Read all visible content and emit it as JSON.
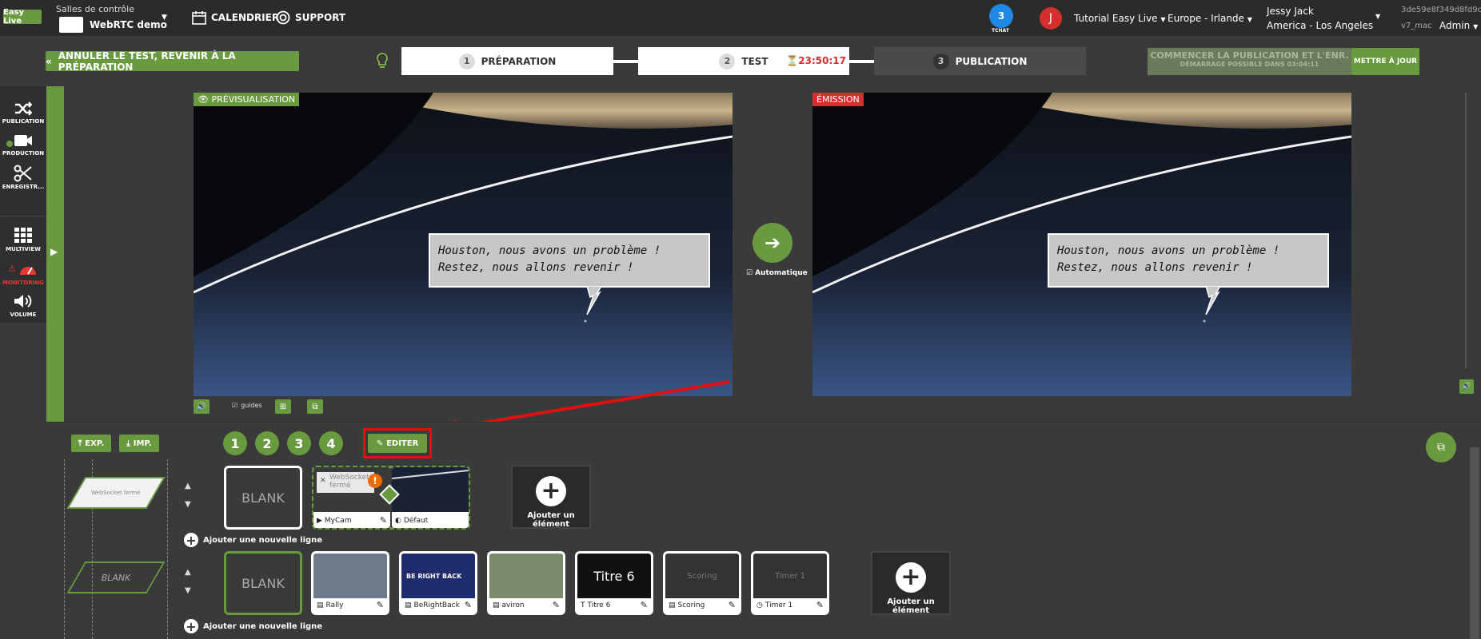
{
  "header": {
    "logo_text": "Easy Live",
    "room_label": "Salles de contrôle",
    "room_name": "WebRTC demo",
    "calendar": "CALENDRIER",
    "support": "SUPPORT",
    "chat_count": "3",
    "chat_label": "TCHAT",
    "user_initial": "J",
    "tutorial": "Tutorial Easy Live",
    "region": "Europe - Irlande",
    "user_name": "Jessy Jack",
    "timezone": "America - Los Angeles",
    "instance_id": "3de59e8f349d8fd9c...",
    "version": "v7_mac",
    "role": "Admin"
  },
  "subbar": {
    "cancel_test": "ANNULER LE TEST, REVENIR À LA PRÉPARATION",
    "steps": [
      {
        "num": "1",
        "label": "PRÉPARATION"
      },
      {
        "num": "2",
        "label": "TEST",
        "timer": "23:50:17"
      },
      {
        "num": "3",
        "label": "PUBLICATION"
      }
    ],
    "start_publication": "COMMENCER LA PUBLICATION ET L'ENR.",
    "start_possible": "DÉMARRAGE POSSIBLE DANS 03:04:11",
    "update": "METTRE À JOUR"
  },
  "sidebar": {
    "items": [
      {
        "label": "PUBLICATION",
        "icon": "shuffle-icon"
      },
      {
        "label": "PRODUCTION",
        "icon": "video-camera-icon"
      },
      {
        "label": "ENREGISTR...",
        "icon": "scissors-icon"
      },
      {
        "label": "MULTIVIEW",
        "icon": "grid-icon"
      },
      {
        "label": "MONITORING",
        "icon": "gauge-icon"
      },
      {
        "label": "VOLUME",
        "icon": "speaker-icon"
      }
    ]
  },
  "preview": {
    "label": "PRÉVISUALISATION",
    "bubble_line1": "Houston, nous avons un problème !",
    "bubble_line2": "Restez, nous allons revenir !",
    "guides": "guides"
  },
  "emission": {
    "label": "ÉMISSION",
    "bubble_line1": "Houston, nous avons un problème !",
    "bubble_line2": "Restez, nous allons revenir !"
  },
  "transition": {
    "auto_label": "Automatique"
  },
  "lower": {
    "exp": "EXP.",
    "imp": "IMP.",
    "scene_numbers": [
      "1",
      "2",
      "3",
      "4"
    ],
    "edit": "EDITER",
    "layout1_label": "WebSocket fermé",
    "layout2_label": "BLANK",
    "row1": {
      "blank": "BLANK",
      "mycam_status": "WebSocket fermé",
      "mycam": "MyCam",
      "default": "Défaut",
      "add_element": "Ajouter un élément",
      "add_line": "Ajouter une nouvelle ligne"
    },
    "row2": {
      "blank": "BLANK",
      "cards": [
        {
          "label": "Rally",
          "thumb": ""
        },
        {
          "label": "BeRightBack",
          "thumb": "BE RIGHT BACK"
        },
        {
          "label": "aviron",
          "thumb": ""
        },
        {
          "label": "Titre 6",
          "thumb": "Titre 6"
        },
        {
          "label": "Scoring",
          "thumb": "Scoring"
        },
        {
          "label": "Timer 1",
          "thumb": "Timer 1"
        }
      ],
      "add_element": "Ajouter un élément",
      "add_line": "Ajouter une nouvelle ligne"
    }
  }
}
